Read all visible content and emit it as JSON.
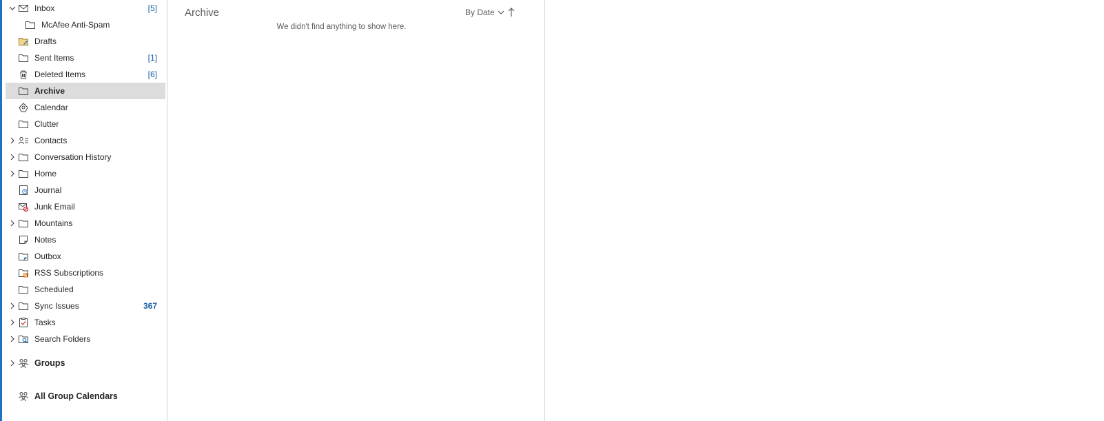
{
  "folders": [
    {
      "label": "Inbox",
      "count": "[5]",
      "icon": "mail-icon",
      "chevron": "down"
    },
    {
      "label": "McAfee Anti-Spam",
      "count": "",
      "icon": "folder-icon",
      "chevron": "",
      "indent": true
    },
    {
      "label": "Drafts",
      "count": "",
      "icon": "drafts-icon",
      "chevron": ""
    },
    {
      "label": "Sent Items",
      "count": "[1]",
      "icon": "folder-icon",
      "chevron": ""
    },
    {
      "label": "Deleted Items",
      "count": "[6]",
      "icon": "trash-icon",
      "chevron": ""
    },
    {
      "label": "Archive",
      "count": "",
      "icon": "folder-icon",
      "chevron": "",
      "selected": true
    },
    {
      "label": "Calendar",
      "count": "",
      "icon": "calendar-icon",
      "chevron": ""
    },
    {
      "label": "Clutter",
      "count": "",
      "icon": "folder-icon",
      "chevron": ""
    },
    {
      "label": "Contacts",
      "count": "",
      "icon": "contacts-icon",
      "chevron": "right"
    },
    {
      "label": "Conversation History",
      "count": "",
      "icon": "folder-icon",
      "chevron": "right"
    },
    {
      "label": "Home",
      "count": "",
      "icon": "folder-icon",
      "chevron": "right"
    },
    {
      "label": "Journal",
      "count": "",
      "icon": "journal-icon",
      "chevron": ""
    },
    {
      "label": "Junk Email",
      "count": "",
      "icon": "junk-icon",
      "chevron": ""
    },
    {
      "label": "Mountains",
      "count": "",
      "icon": "folder-icon",
      "chevron": "right"
    },
    {
      "label": "Notes",
      "count": "",
      "icon": "notes-icon",
      "chevron": ""
    },
    {
      "label": "Outbox",
      "count": "",
      "icon": "outbox-icon",
      "chevron": ""
    },
    {
      "label": "RSS Subscriptions",
      "count": "",
      "icon": "rss-icon",
      "chevron": ""
    },
    {
      "label": "Scheduled",
      "count": "",
      "icon": "folder-icon",
      "chevron": ""
    },
    {
      "label": "Sync Issues",
      "count": "367",
      "icon": "folder-icon",
      "chevron": "right",
      "count_bold": true
    },
    {
      "label": "Tasks",
      "count": "",
      "icon": "tasks-icon",
      "chevron": "right"
    },
    {
      "label": "Search Folders",
      "count": "",
      "icon": "search-folder-icon",
      "chevron": "right"
    }
  ],
  "groups": {
    "label": "Groups",
    "icon": "groups-icon"
  },
  "all_group_calendars": {
    "label": "All Group Calendars",
    "icon": "groups-icon"
  },
  "list": {
    "title": "Archive",
    "sort_label": "By Date",
    "empty_message": "We didn't find anything to show here."
  },
  "colors": {
    "accent": "#1e73be",
    "count": "#1e5fa8",
    "selected_bg": "#dcdcdc"
  }
}
